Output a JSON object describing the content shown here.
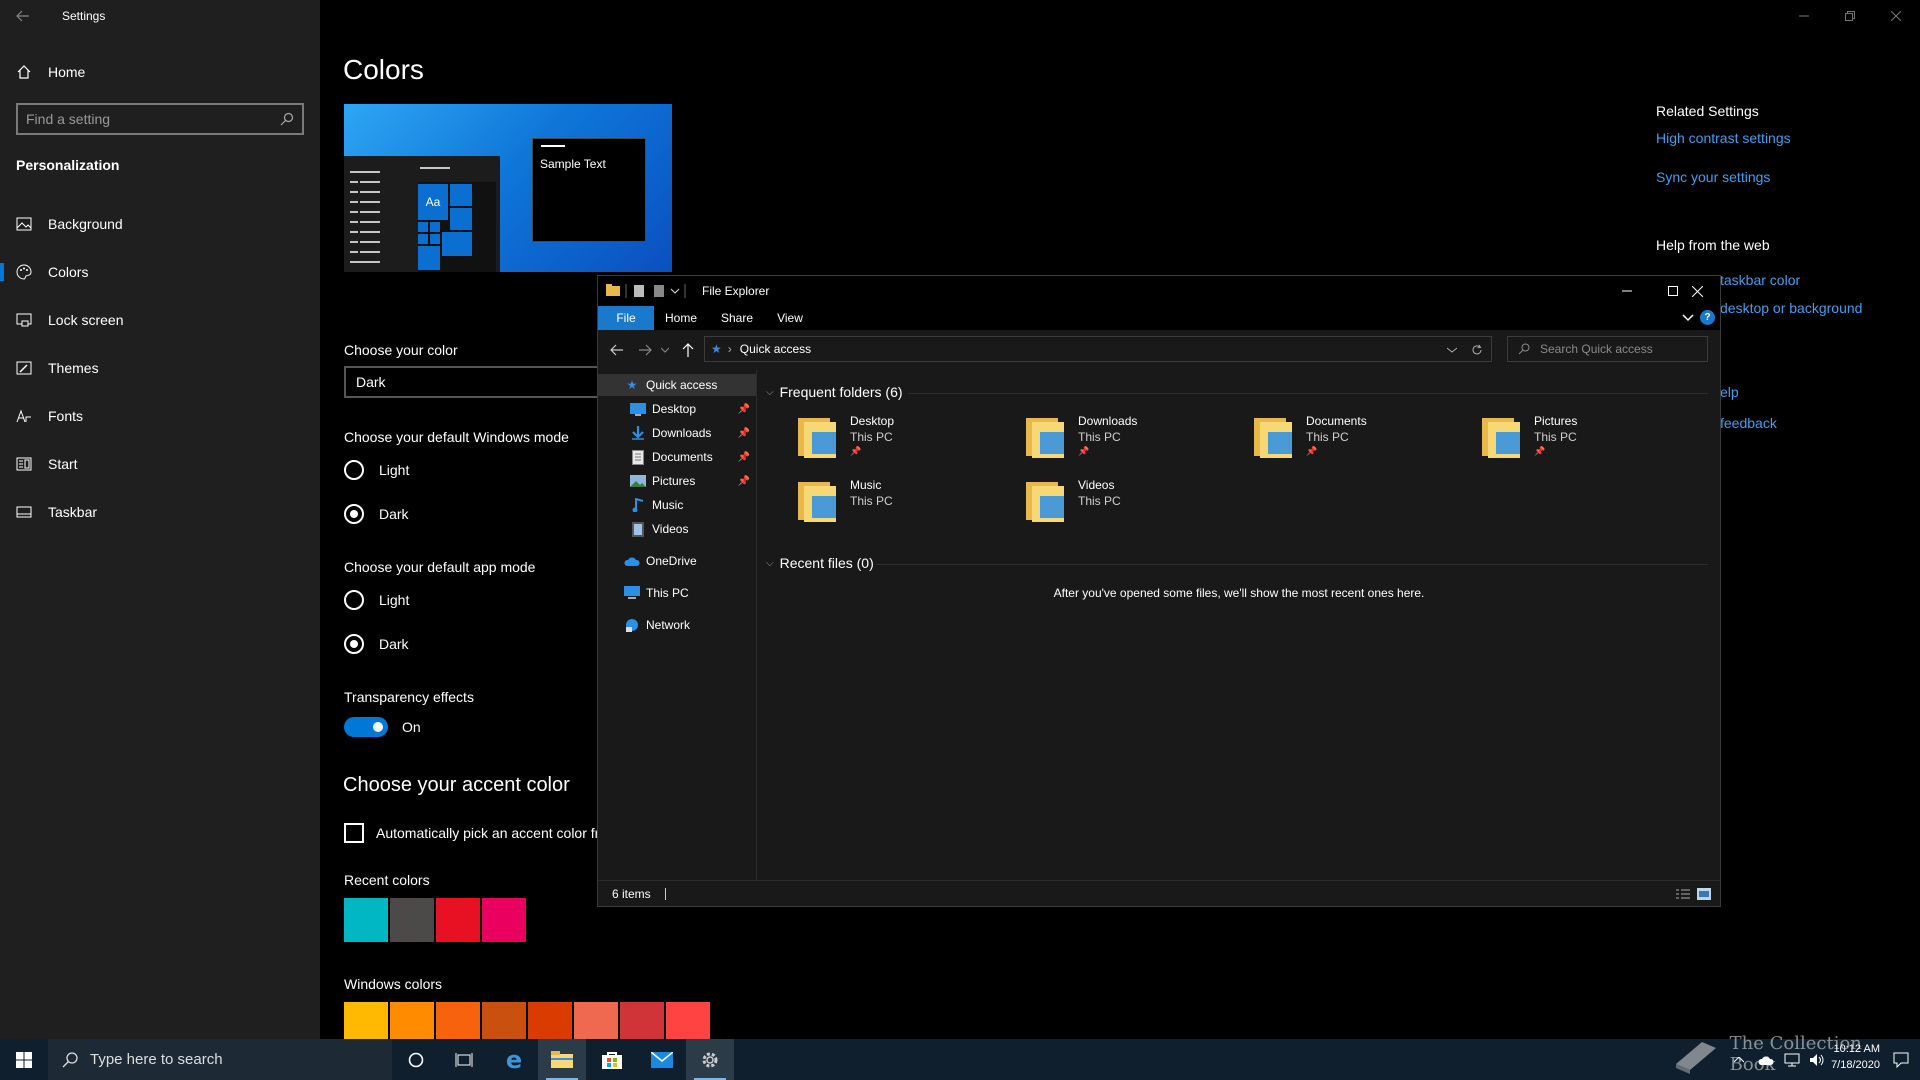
{
  "settings": {
    "app_title": "Settings",
    "search_placeholder": "Find a setting",
    "home_label": "Home",
    "section_label": "Personalization",
    "nav": [
      {
        "label": "Background",
        "icon": "picture-icon"
      },
      {
        "label": "Colors",
        "icon": "palette-icon"
      },
      {
        "label": "Lock screen",
        "icon": "lock-screen-icon"
      },
      {
        "label": "Themes",
        "icon": "brush-icon"
      },
      {
        "label": "Fonts",
        "icon": "font-icon"
      },
      {
        "label": "Start",
        "icon": "start-icon"
      },
      {
        "label": "Taskbar",
        "icon": "taskbar-icon"
      }
    ],
    "active_nav": "Colors"
  },
  "colors_page": {
    "title": "Colors",
    "preview_sample_text": "Sample Text",
    "preview_tile_text": "Aa",
    "choose_color_label": "Choose your color",
    "choose_color_value": "Dark",
    "windows_mode_label": "Choose your default Windows mode",
    "app_mode_label": "Choose your default app mode",
    "light_label": "Light",
    "dark_label": "Dark",
    "windows_mode_selected": "Dark",
    "app_mode_selected": "Dark",
    "transparency_label": "Transparency effects",
    "transparency_value": "On",
    "accent_heading": "Choose your accent color",
    "auto_pick_label": "Automatically pick an accent color fr",
    "recent_colors_label": "Recent colors",
    "recent_colors": [
      "#00b7c3",
      "#4c4a48",
      "#e81123",
      "#ea005e"
    ],
    "windows_colors_label": "Windows colors",
    "windows_colors": [
      "#ffb900",
      "#ff8c00",
      "#f7630c",
      "#ca5010",
      "#da3b01",
      "#ef6950",
      "#d13438",
      "#ff4343"
    ]
  },
  "related": {
    "heading": "Related Settings",
    "links": [
      "High contrast settings",
      "Sync your settings"
    ],
    "help_heading": "Help from the web",
    "help_links": [
      "taskbar color",
      "desktop or background"
    ],
    "extra_links": [
      "elp",
      "feedback"
    ]
  },
  "explorer": {
    "title": "File Explorer",
    "ribbon_tabs": [
      "File",
      "Home",
      "Share",
      "View"
    ],
    "address": "Quick access",
    "search_placeholder": "Search Quick access",
    "nav": [
      {
        "label": "Quick access",
        "icon": "star-icon",
        "pinned": false
      },
      {
        "label": "Desktop",
        "icon": "desktop-icon",
        "pinned": true
      },
      {
        "label": "Downloads",
        "icon": "download-icon",
        "pinned": true
      },
      {
        "label": "Documents",
        "icon": "documents-icon",
        "pinned": true
      },
      {
        "label": "Pictures",
        "icon": "pictures-icon",
        "pinned": true
      },
      {
        "label": "Music",
        "icon": "music-icon",
        "pinned": false
      },
      {
        "label": "Videos",
        "icon": "videos-icon",
        "pinned": false
      },
      {
        "label": "OneDrive",
        "icon": "cloud-icon",
        "pinned": false
      },
      {
        "label": "This PC",
        "icon": "computer-icon",
        "pinned": false
      },
      {
        "label": "Network",
        "icon": "network-icon",
        "pinned": false
      }
    ],
    "frequent_heading": "Frequent folders (6)",
    "folders": [
      {
        "name": "Desktop",
        "location": "This PC",
        "pinned": true
      },
      {
        "name": "Downloads",
        "location": "This PC",
        "pinned": true
      },
      {
        "name": "Documents",
        "location": "This PC",
        "pinned": true
      },
      {
        "name": "Pictures",
        "location": "This PC",
        "pinned": true
      },
      {
        "name": "Music",
        "location": "This PC",
        "pinned": false
      },
      {
        "name": "Videos",
        "location": "This PC",
        "pinned": false
      }
    ],
    "recent_heading": "Recent files (0)",
    "recent_empty": "After you've opened some files, we'll show the most recent ones here.",
    "status": "6 items"
  },
  "taskbar": {
    "search_placeholder": "Type here to search",
    "time": "10:12 AM",
    "date": "7/18/2020",
    "watermark": "The Collection Book"
  },
  "colors": {
    "accent": "#0078d7",
    "link": "#3aa0f3",
    "folder": "#f8d775"
  }
}
